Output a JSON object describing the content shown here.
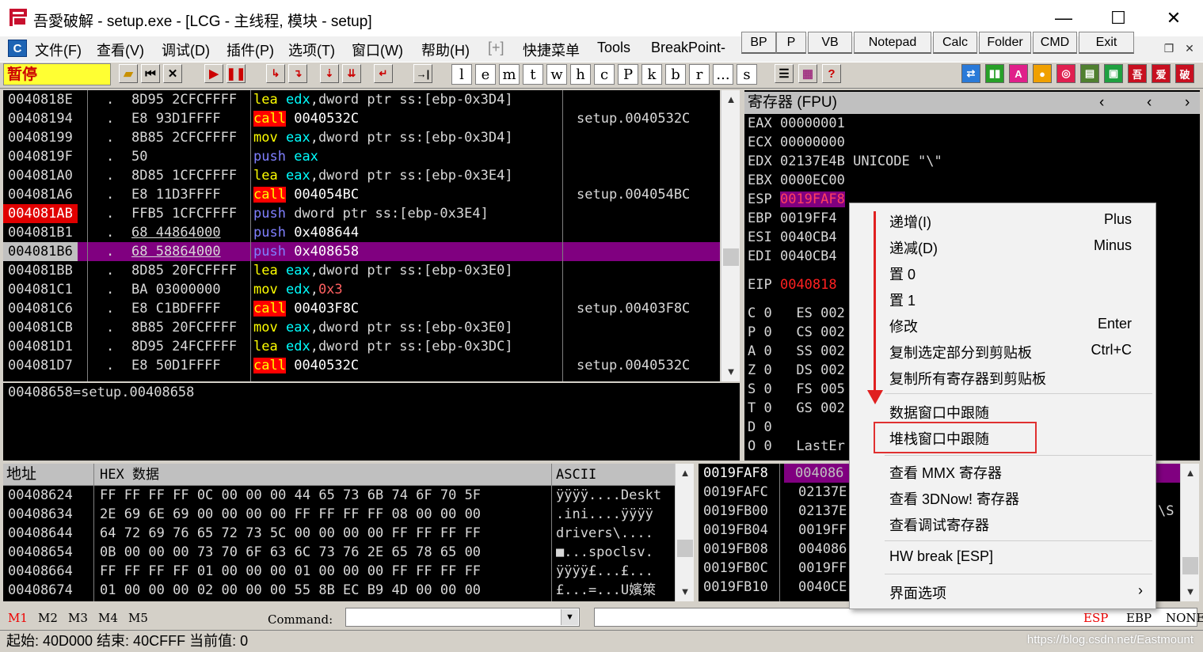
{
  "window": {
    "title": "吾愛破解 - setup.exe - [LCG -  主线程, 模块 - setup]",
    "minimize": "—",
    "maximize": "☐",
    "close": "✕"
  },
  "menu": [
    "文件(F)",
    "查看(V)",
    "调试(D)",
    "插件(P)",
    "选项(T)",
    "窗口(W)",
    "帮助(H)",
    "[+]",
    "快捷菜单",
    "Tools",
    "BreakPoint-"
  ],
  "top_buttons": [
    "BP",
    "P",
    "VB",
    "Notepad",
    "Calc",
    "Folder",
    "CMD",
    "Exit"
  ],
  "status_state": "暂停",
  "toolbar_letters": [
    "l",
    "e",
    "m",
    "t",
    "w",
    "h",
    "c",
    "P",
    "k",
    "b",
    "r",
    "...",
    "s"
  ],
  "cpu": {
    "rows": [
      {
        "addr": "0040818E",
        "mark": ".",
        "hex": "8D95 2CFCFFFF",
        "op": "lea",
        "args": [
          [
            "reg",
            "edx"
          ],
          [
            "t",
            ","
          ],
          [
            "t",
            "dword ptr ss:[ebp-0x3D4]"
          ]
        ],
        "cmt": ""
      },
      {
        "addr": "00408194",
        "mark": ".",
        "hex": "E8 93D1FFFF",
        "op": "call",
        "args": [
          [
            "t",
            "0040532C"
          ]
        ],
        "cmt": "setup.0040532C"
      },
      {
        "addr": "00408199",
        "mark": ".",
        "hex": "8B85 2CFCFFFF",
        "op": "mov",
        "args": [
          [
            "reg",
            "eax"
          ],
          [
            "t",
            ","
          ],
          [
            "t",
            "dword ptr ss:[ebp-0x3D4]"
          ]
        ],
        "cmt": ""
      },
      {
        "addr": "0040819F",
        "mark": ".",
        "hex": "50",
        "op": "push",
        "args": [
          [
            "reg",
            "eax"
          ]
        ],
        "cmt": ""
      },
      {
        "addr": "004081A0",
        "mark": ".",
        "hex": "8D85 1CFCFFFF",
        "op": "lea",
        "args": [
          [
            "reg",
            "eax"
          ],
          [
            "t",
            ","
          ],
          [
            "t",
            "dword ptr ss:[ebp-0x3E4]"
          ]
        ],
        "cmt": ""
      },
      {
        "addr": "004081A6",
        "mark": ".",
        "hex": "E8 11D3FFFF",
        "op": "call",
        "args": [
          [
            "t",
            "004054BC"
          ]
        ],
        "cmt": "setup.004054BC"
      },
      {
        "addr": "004081AB",
        "mark": ".",
        "hex": "FFB5 1CFCFFFF",
        "op": "push",
        "args": [
          [
            "t",
            "dword ptr ss:[ebp-0x3E4]"
          ]
        ],
        "cmt": ""
      },
      {
        "addr": "004081B1",
        "mark": ".",
        "hex": "68 44864000",
        "op": "push",
        "args": [
          [
            "t",
            "0x408644"
          ]
        ],
        "cmt": ""
      },
      {
        "addr": "004081B6",
        "mark": ".",
        "hex": "68 58864000",
        "op": "push",
        "args": [
          [
            "t",
            "0x408658"
          ]
        ],
        "cmt": ""
      },
      {
        "addr": "004081BB",
        "mark": ".",
        "hex": "8D85 20FCFFFF",
        "op": "lea",
        "args": [
          [
            "reg",
            "eax"
          ],
          [
            "t",
            ","
          ],
          [
            "t",
            "dword ptr ss:[ebp-0x3E0]"
          ]
        ],
        "cmt": ""
      },
      {
        "addr": "004081C1",
        "mark": ".",
        "hex": "BA 03000000",
        "op": "mov",
        "args": [
          [
            "reg",
            "edx"
          ],
          [
            "t",
            ","
          ],
          [
            "num",
            "0x3"
          ]
        ],
        "cmt": ""
      },
      {
        "addr": "004081C6",
        "mark": ".",
        "hex": "E8 C1BDFFFF",
        "op": "call",
        "args": [
          [
            "t",
            "00403F8C"
          ]
        ],
        "cmt": "setup.00403F8C"
      },
      {
        "addr": "004081CB",
        "mark": ".",
        "hex": "8B85 20FCFFFF",
        "op": "mov",
        "args": [
          [
            "reg",
            "eax"
          ],
          [
            "t",
            ","
          ],
          [
            "t",
            "dword ptr ss:[ebp-0x3E0]"
          ]
        ],
        "cmt": ""
      },
      {
        "addr": "004081D1",
        "mark": ".",
        "hex": "8D95 24FCFFFF",
        "op": "lea",
        "args": [
          [
            "reg",
            "edx"
          ],
          [
            "t",
            ","
          ],
          [
            "t",
            "dword ptr ss:[ebp-0x3DC]"
          ]
        ],
        "cmt": ""
      },
      {
        "addr": "004081D7",
        "mark": ".",
        "hex": "E8 50D1FFFF",
        "op": "call",
        "args": [
          [
            "t",
            "0040532C"
          ]
        ],
        "cmt": "setup.0040532C"
      }
    ],
    "info": "00408658=setup.00408658"
  },
  "registers": {
    "header": "寄存器 (FPU)",
    "lines": [
      {
        "name": "EAX",
        "val": "00000001",
        "extra": ""
      },
      {
        "name": "ECX",
        "val": "00000000",
        "extra": ""
      },
      {
        "name": "EDX",
        "val": "02137E4B",
        "extra": "UNICODE \"\\\""
      },
      {
        "name": "EBX",
        "val": "0000EC00",
        "extra": ""
      },
      {
        "name": "ESP",
        "val": "0019FAF8",
        "extra": ""
      },
      {
        "name": "EBP",
        "val": "0019FF4",
        "extra": ""
      },
      {
        "name": "ESI",
        "val": "0040CB4",
        "extra": ""
      },
      {
        "name": "EDI",
        "val": "0040CB4",
        "extra": ""
      },
      {
        "name": "EIP",
        "val": "0040818",
        "extra": ""
      }
    ],
    "flags": [
      "C 0   ES 002",
      "P 0   CS 002",
      "A 0   SS 002",
      "Z 0   DS 002",
      "S 0   FS 005",
      "T 0   GS 002",
      "D 0",
      "O 0   LastEr"
    ]
  },
  "dump": {
    "col_addr": "地址",
    "col_hex": "HEX 数据",
    "col_ascii": "ASCII",
    "rows": [
      {
        "addr": "00408624",
        "hex": "FF FF FF FF 0C 00 00 00 44 65 73 6B 74 6F 70 5F",
        "ascii": "ÿÿÿÿ....Deskt"
      },
      {
        "addr": "00408634",
        "hex": "2E 69 6E 69 00 00 00 00 FF FF FF FF 08 00 00 00",
        "ascii": ".ini....ÿÿÿÿ"
      },
      {
        "addr": "00408644",
        "hex": "64 72 69 76 65 72 73 5C 00 00 00 00 FF FF FF FF",
        "ascii": "drivers\\...."
      },
      {
        "addr": "00408654",
        "hex": "0B 00 00 00 73 70 6F 63 6C 73 76 2E 65 78 65 00",
        "ascii": "■...spoclsv."
      },
      {
        "addr": "00408664",
        "hex": "FF FF FF FF 01 00 00 00 01 00 00 00 FF FF FF FF",
        "ascii": "ÿÿÿÿ£...£..."
      },
      {
        "addr": "00408674",
        "hex": "01 00 00 00 02 00 00 00 55 8B EC B9 4D 00 00 00",
        "ascii": "£...=...U嬪箂"
      }
    ]
  },
  "stack": {
    "header_addr": "0019FAF8",
    "header_val": "004086",
    "rows": [
      {
        "addr": "0019FAFC",
        "val": "02137E"
      },
      {
        "addr": "0019FB00",
        "val": "02137E"
      },
      {
        "addr": "0019FB04",
        "val": "0019FF"
      },
      {
        "addr": "0019FB08",
        "val": "004086"
      },
      {
        "addr": "0019FB0C",
        "val": "0019FF"
      },
      {
        "addr": "0019FB10",
        "val": "0040CE"
      }
    ],
    "right_frag": "\\S"
  },
  "cmdbar": {
    "tabs": [
      "M1",
      "M2",
      "M3",
      "M4",
      "M5"
    ],
    "label": "Command:",
    "reg_tabs": [
      "ESP",
      "EBP",
      "NONE"
    ]
  },
  "statusbar": {
    "text": "起始: 40D000  结束: 40CFFF  当前值: 0"
  },
  "watermark": "https://blog.csdn.net/Eastmount",
  "context_menu": {
    "items": [
      {
        "label": "递增(I)",
        "key": "Plus"
      },
      {
        "label": "递减(D)",
        "key": "Minus"
      },
      {
        "label": "置 0",
        "key": ""
      },
      {
        "label": "置 1",
        "key": ""
      },
      {
        "label": "修改",
        "key": "Enter"
      },
      {
        "label": "复制选定部分到剪贴板",
        "key": "Ctrl+C"
      },
      {
        "label": "复制所有寄存器到剪贴板",
        "key": ""
      },
      {
        "label": "数据窗口中跟随",
        "key": ""
      },
      {
        "label": "堆栈窗口中跟随",
        "key": ""
      },
      {
        "label": "查看 MMX 寄存器",
        "key": ""
      },
      {
        "label": "查看 3DNow! 寄存器",
        "key": ""
      },
      {
        "label": "查看调试寄存器",
        "key": ""
      },
      {
        "label": "HW break [ESP]",
        "key": ""
      },
      {
        "label": "界面选项",
        "key": ""
      }
    ],
    "submenu_arrow": "›"
  },
  "colors": {
    "highlight_row": "#800080",
    "annotation": "#e02020",
    "paused": "#ffff33"
  }
}
